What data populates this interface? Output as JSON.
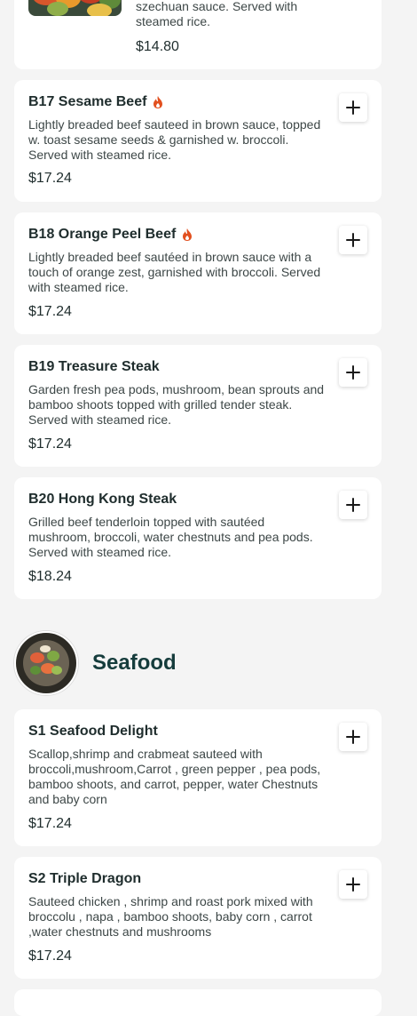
{
  "top_card": {
    "desc_tail": "szechuan sauce. Served with steamed rice.",
    "price": "$14.80"
  },
  "beef_items": [
    {
      "name": "B17 Sesame Beef",
      "spicy": true,
      "desc": "Lightly breaded beef sauteed in brown sauce, topped w. toast sesame seeds & garnished w. broccoli. Served with steamed rice.",
      "price": "$17.24"
    },
    {
      "name": "B18 Orange Peel Beef",
      "spicy": true,
      "desc": "Lightly breaded beef sautéed in brown sauce with a touch of orange zest, garnished with broccoli. Served with steamed rice.",
      "price": "$17.24"
    },
    {
      "name": "B19 Treasure Steak",
      "spicy": false,
      "desc": "Garden fresh pea pods, mushroom, bean sprouts and bamboo shoots topped with grilled tender steak. Served with steamed rice.",
      "price": "$17.24"
    },
    {
      "name": "B20 Hong Kong Steak",
      "spicy": false,
      "desc": "Grilled beef tenderloin topped with sautéed mushroom, broccoli, water chestnuts and pea pods. Served with steamed rice.",
      "price": "$18.24"
    }
  ],
  "seafood_section": {
    "title": "Seafood"
  },
  "seafood_items": [
    {
      "name": "S1 Seafood Delight",
      "spicy": false,
      "desc": "Scallop,shrimp and crabmeat sauteed with broccoli,mushroom,Carrot , green pepper , pea pods, bamboo shoots, and carrot, pepper, water Chestnuts and baby corn",
      "price": "$17.24"
    },
    {
      "name": "S2 Triple Dragon",
      "spicy": false,
      "desc": "Sauteed chicken , shrimp and roast pork mixed with broccolu , napa , bamboo shoots, baby corn , carrot ,water chestnuts and mushrooms",
      "price": "$17.24"
    }
  ],
  "icons": {
    "add": "plus-icon",
    "spicy": "fire-icon"
  },
  "colors": {
    "background": "#f4f4f4",
    "card": "#ffffff",
    "text": "#1f2d2d",
    "section_title": "#153c3c",
    "spicy": "#e2501f"
  }
}
